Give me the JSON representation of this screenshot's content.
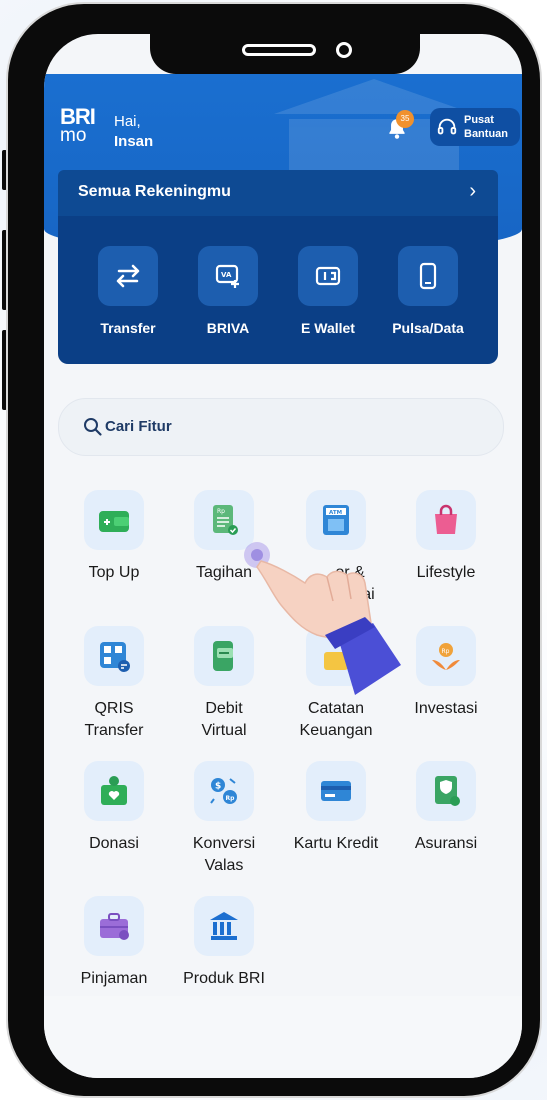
{
  "header": {
    "logo_top": "BRI",
    "logo_bottom": "mo",
    "greeting": "Hai,",
    "user_name": "Insan",
    "notification_count": "35",
    "help_line1": "Pusat",
    "help_line2": "Bantuan"
  },
  "accounts": {
    "label": "Semua Rekeningmu",
    "chevron": "›"
  },
  "quick_actions": [
    {
      "label": "Transfer",
      "icon": "transfer-arrows-icon"
    },
    {
      "label": "BRIVA",
      "icon": "briva-icon"
    },
    {
      "label": "E Wallet",
      "icon": "wallet-icon"
    },
    {
      "label": "Pulsa/Data",
      "icon": "phone-icon"
    }
  ],
  "search": {
    "placeholder": "Cari Fitur"
  },
  "features": [
    {
      "label": "Top Up",
      "icon": "topup-wallet-icon"
    },
    {
      "label": "Tagihan",
      "icon": "bill-icon"
    },
    {
      "label": "Tarik Setor & Tunai",
      "label_visible_1": "or &",
      "label_visible_2": "nai",
      "icon": "atm-icon"
    },
    {
      "label": "Lifestyle",
      "icon": "shopping-bag-icon"
    },
    {
      "label1": "QRIS",
      "label2": "Transfer",
      "icon": "qris-icon"
    },
    {
      "label1": "Debit",
      "label2": "Virtual",
      "icon": "debit-virtual-icon"
    },
    {
      "label1": "Catatan",
      "label2": "Keuangan",
      "icon": "notes-icon"
    },
    {
      "label": "Investasi",
      "icon": "investment-icon"
    },
    {
      "label": "Donasi",
      "icon": "donation-icon"
    },
    {
      "label1": "Konversi",
      "label2": "Valas",
      "icon": "currency-exchange-icon"
    },
    {
      "label": "Kartu Kredit",
      "icon": "credit-card-icon"
    },
    {
      "label": "Asuransi",
      "icon": "insurance-icon"
    },
    {
      "label": "Pinjaman",
      "icon": "loan-briefcase-icon"
    },
    {
      "label": "Produk BRI",
      "icon": "bank-building-icon"
    }
  ],
  "colors": {
    "primary_blue": "#1a6fd0",
    "dark_blue": "#0b3f86",
    "badge_orange": "#f0912d"
  }
}
